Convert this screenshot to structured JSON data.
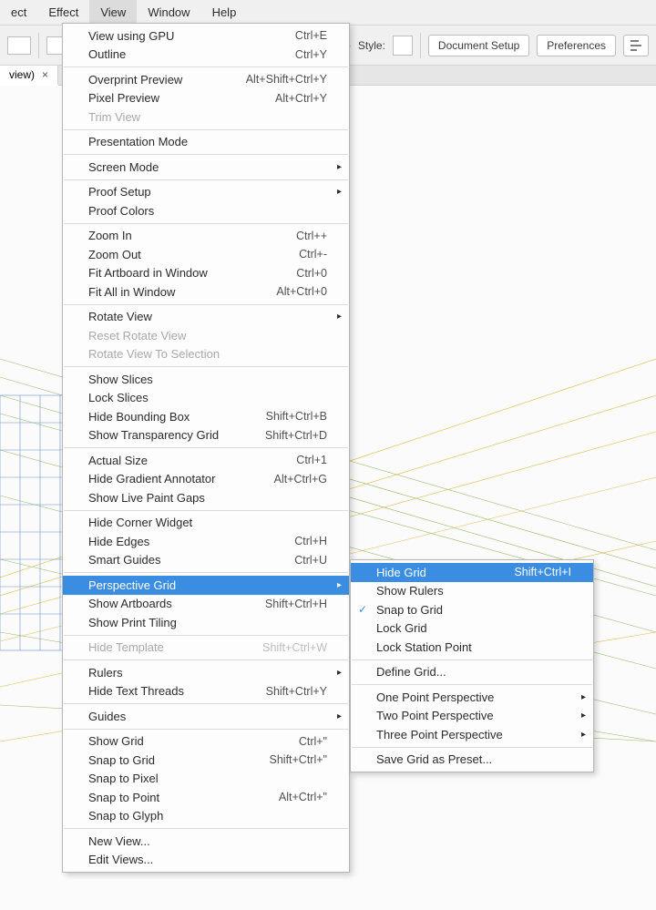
{
  "menubar": {
    "items": [
      "ect",
      "Effect",
      "View",
      "Window",
      "Help"
    ],
    "active_index": 2
  },
  "toolbar": {
    "style_label": "Style:",
    "doc_setup_label": "Document Setup",
    "prefs_label": "Preferences"
  },
  "tab": {
    "title": "view)",
    "close_glyph": "×"
  },
  "view_menu": [
    {
      "label": "View using GPU",
      "shortcut": "Ctrl+E"
    },
    {
      "label": "Outline",
      "shortcut": "Ctrl+Y"
    },
    {
      "sep": true
    },
    {
      "label": "Overprint Preview",
      "shortcut": "Alt+Shift+Ctrl+Y"
    },
    {
      "label": "Pixel Preview",
      "shortcut": "Alt+Ctrl+Y"
    },
    {
      "label": "Trim View",
      "disabled": true
    },
    {
      "sep": true
    },
    {
      "label": "Presentation Mode"
    },
    {
      "sep": true
    },
    {
      "label": "Screen Mode",
      "submenu": true
    },
    {
      "sep": true
    },
    {
      "label": "Proof Setup",
      "submenu": true
    },
    {
      "label": "Proof Colors"
    },
    {
      "sep": true
    },
    {
      "label": "Zoom In",
      "shortcut": "Ctrl++"
    },
    {
      "label": "Zoom Out",
      "shortcut": "Ctrl+-"
    },
    {
      "label": "Fit Artboard in Window",
      "shortcut": "Ctrl+0"
    },
    {
      "label": "Fit All in Window",
      "shortcut": "Alt+Ctrl+0"
    },
    {
      "sep": true
    },
    {
      "label": "Rotate View",
      "submenu": true
    },
    {
      "label": "Reset Rotate View",
      "disabled": true
    },
    {
      "label": "Rotate View To Selection",
      "disabled": true
    },
    {
      "sep": true
    },
    {
      "label": "Show Slices"
    },
    {
      "label": "Lock Slices"
    },
    {
      "label": "Hide Bounding Box",
      "shortcut": "Shift+Ctrl+B"
    },
    {
      "label": "Show Transparency Grid",
      "shortcut": "Shift+Ctrl+D"
    },
    {
      "sep": true
    },
    {
      "label": "Actual Size",
      "shortcut": "Ctrl+1"
    },
    {
      "label": "Hide Gradient Annotator",
      "shortcut": "Alt+Ctrl+G"
    },
    {
      "label": "Show Live Paint Gaps"
    },
    {
      "sep": true
    },
    {
      "label": "Hide Corner Widget"
    },
    {
      "label": "Hide Edges",
      "shortcut": "Ctrl+H"
    },
    {
      "label": "Smart Guides",
      "shortcut": "Ctrl+U"
    },
    {
      "sep": true
    },
    {
      "label": "Perspective Grid",
      "submenu": true,
      "highlight": true
    },
    {
      "label": "Show Artboards",
      "shortcut": "Shift+Ctrl+H"
    },
    {
      "label": "Show Print Tiling"
    },
    {
      "sep": true
    },
    {
      "label": "Hide Template",
      "shortcut": "Shift+Ctrl+W",
      "disabled": true
    },
    {
      "sep": true
    },
    {
      "label": "Rulers",
      "submenu": true
    },
    {
      "label": "Hide Text Threads",
      "shortcut": "Shift+Ctrl+Y"
    },
    {
      "sep": true
    },
    {
      "label": "Guides",
      "submenu": true
    },
    {
      "sep": true
    },
    {
      "label": "Show Grid",
      "shortcut": "Ctrl+\""
    },
    {
      "label": "Snap to Grid",
      "shortcut": "Shift+Ctrl+\""
    },
    {
      "label": "Snap to Pixel"
    },
    {
      "label": "Snap to Point",
      "shortcut": "Alt+Ctrl+\""
    },
    {
      "label": "Snap to Glyph"
    },
    {
      "sep": true
    },
    {
      "label": "New View..."
    },
    {
      "label": "Edit Views..."
    }
  ],
  "persp_submenu": [
    {
      "label": "Hide Grid",
      "shortcut": "Shift+Ctrl+I",
      "highlight": true
    },
    {
      "label": "Show Rulers"
    },
    {
      "label": "Snap to Grid",
      "checked": true
    },
    {
      "label": "Lock Grid"
    },
    {
      "label": "Lock Station Point"
    },
    {
      "sep": true
    },
    {
      "label": "Define Grid..."
    },
    {
      "sep": true
    },
    {
      "label": "One Point Perspective",
      "submenu": true
    },
    {
      "label": "Two Point Perspective",
      "submenu": true
    },
    {
      "label": "Three Point Perspective",
      "submenu": true
    },
    {
      "sep": true
    },
    {
      "label": "Save Grid as Preset..."
    }
  ],
  "glyphs": {
    "arrow": "▸",
    "check": "✓"
  }
}
